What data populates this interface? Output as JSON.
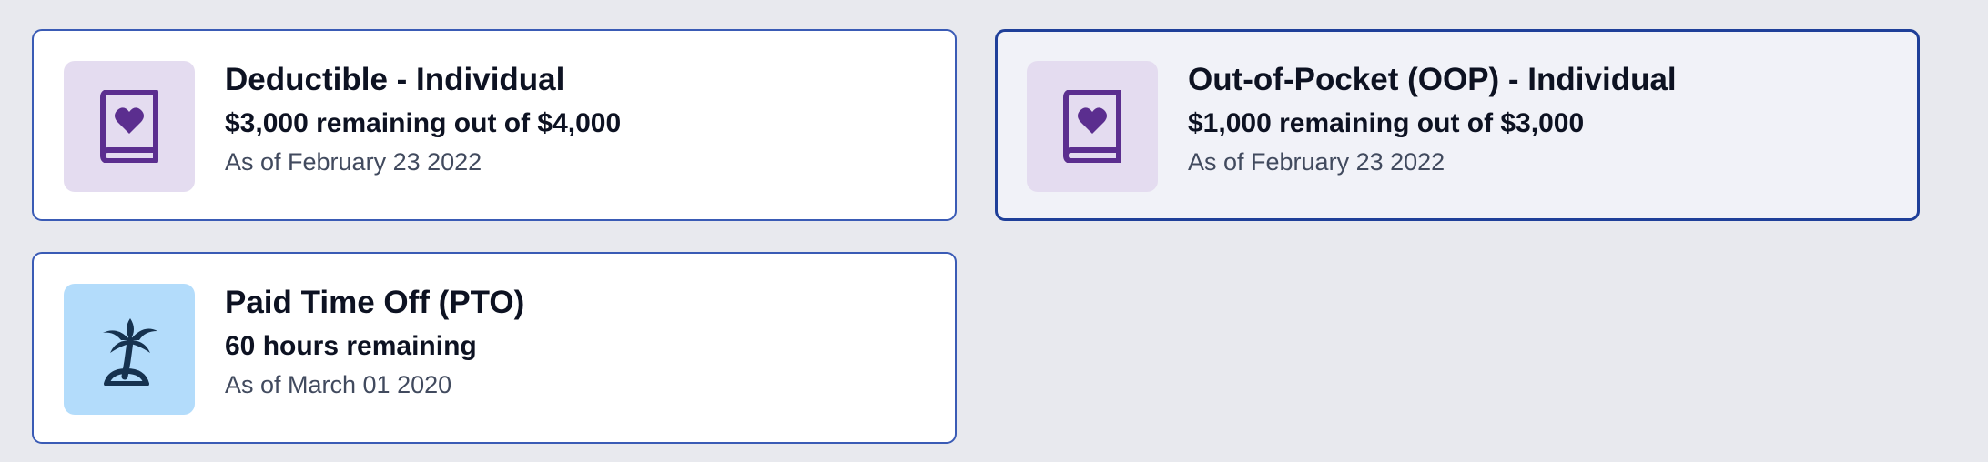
{
  "cards": [
    {
      "title": "Deductible - Individual",
      "amount_text": "$3,000 remaining out of $4,000",
      "as_of": "As of February 23 2022",
      "icon": "book-heart-icon",
      "icon_bg": "#e4dcf0",
      "icon_color": "#5b2e8f",
      "selected": false
    },
    {
      "title": "Out-of-Pocket (OOP) - Individual",
      "amount_text": "$1,000 remaining out of $3,000",
      "as_of": "As of February 23 2022",
      "icon": "book-heart-icon",
      "icon_bg": "#e4dcf0",
      "icon_color": "#5b2e8f",
      "selected": true
    },
    {
      "title": "Paid Time Off (PTO)",
      "amount_text": "60 hours remaining",
      "as_of": "As of March 01 2020",
      "icon": "palm-tree-island-icon",
      "icon_bg": "#b3dcfb",
      "icon_color": "#16324f",
      "selected": false
    }
  ],
  "colors": {
    "page_bg": "#e8e9ee",
    "card_border": "#3a5bb5",
    "selected_border": "#1f3f99",
    "selected_bg": "#f1f2f8",
    "text_primary": "#0d1222",
    "text_secondary": "#414a5e"
  }
}
